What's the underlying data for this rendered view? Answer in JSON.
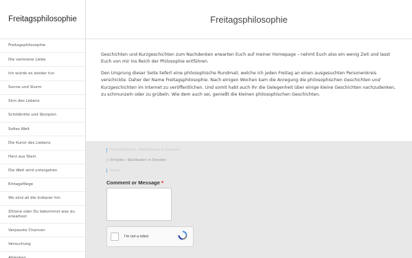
{
  "site": {
    "title": "Freitagsphilosophie"
  },
  "sidebar": {
    "items": [
      {
        "label": "Freitagsphilosophie"
      },
      {
        "label": "Die verlorene Liebe"
      },
      {
        "label": "Ich würde es wieder tun"
      },
      {
        "label": "Sonne und Sturm"
      },
      {
        "label": "Sinn des Lebens"
      },
      {
        "label": "Schildkröte und Skorpion"
      },
      {
        "label": "Sofies Welt"
      },
      {
        "label": "Die Kunst des Liebens"
      },
      {
        "label": "Herz aus Stein"
      },
      {
        "label": "Die Welt wird untergehen"
      },
      {
        "label": "Eintagsfliege"
      },
      {
        "label": "Wo sind all die Indianer hin"
      },
      {
        "label": "Zitrone oder Du bekommst was du erwartest"
      },
      {
        "label": "Verpasste Chancen"
      },
      {
        "label": "Versuchung"
      },
      {
        "label": "Ablenken"
      }
    ]
  },
  "page": {
    "heading": "Freitagsphilosophie",
    "paragraph1": "Geschichten und Kurzgeschichten zum Nachdenken erwarten Euch auf meiner Homepage – nehmt  Euch also ein wenig Zeit und lasst Euch von mir ins Reich der Philosophie entführen.",
    "paragraph2_part1": "Den Ursprung dieser Seite liefert eine philosophische Rundmail, welche ich jeden Freitag an einen ausgesuchten Personenkreis verschickte. Daher der Name Freitagsphilosophie. Nach einigen Wochen kam die Anregung die philosophischen ",
    "paragraph2_italic": "Geschichten und Kurzgeschichten",
    "paragraph2_part2": " im Internet zu veröffentlichen. Und somit habt auch Ihr die Gelegenheit über einige kleine Geschichten nachzudenken, zu schmunzeln oder zu grübeln.  Wie dem auch sei, genießt die kleinen philosophischen Geschichten."
  },
  "comments": {
    "faint_link": "Hochzeitsband - Wahlbbaden in Dresden",
    "faint_link2": "○  Eritwike - Wahlbaden in Dresden",
    "faint_label": "Name",
    "comment_label": "Comment or Message",
    "required_mark": "*",
    "captcha_text": "I'm not a robot"
  }
}
